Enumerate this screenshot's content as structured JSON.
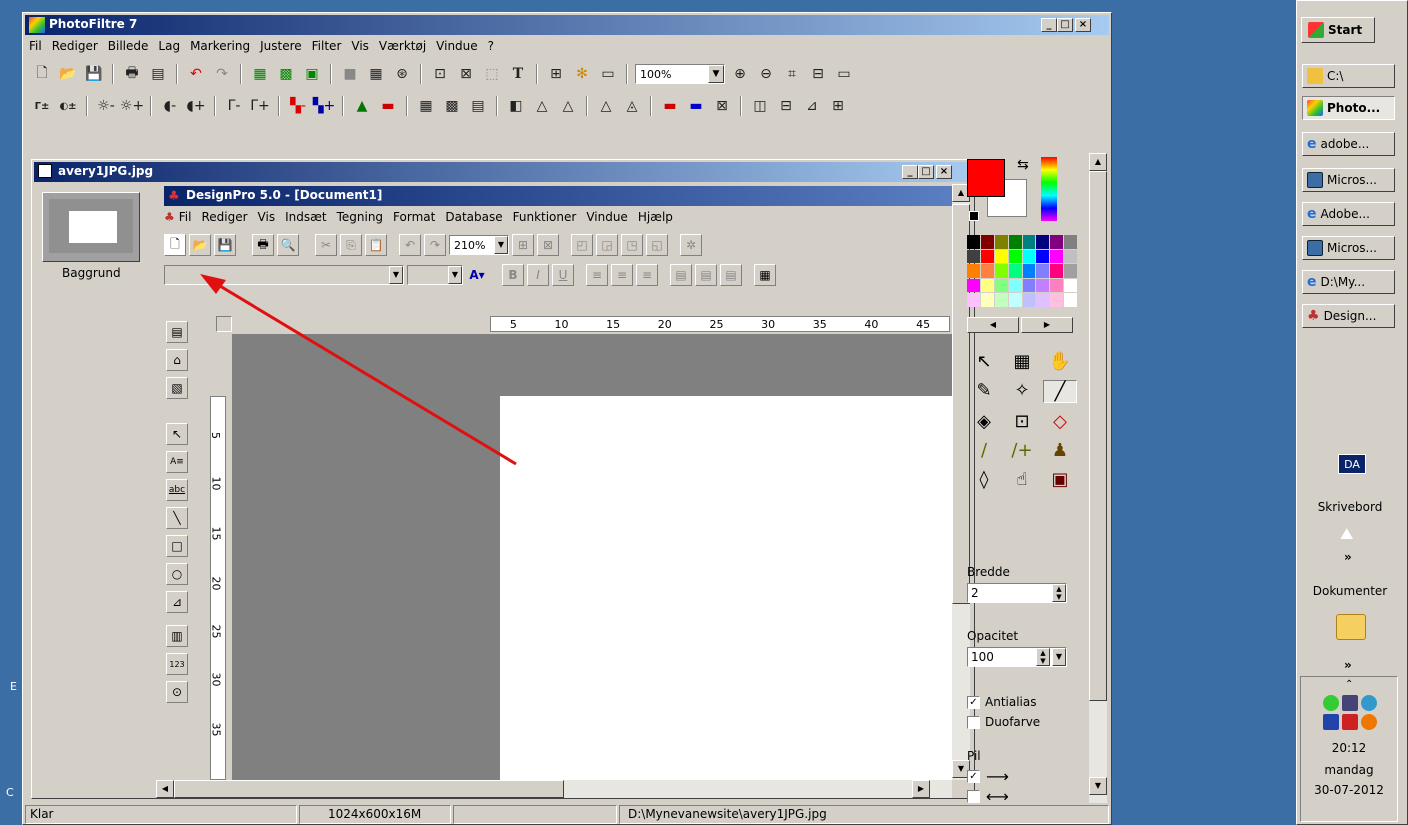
{
  "pf": {
    "title": "PhotoFiltre 7",
    "menu": [
      "Fil",
      "Rediger",
      "Billede",
      "Lag",
      "Markering",
      "Justere",
      "Filter",
      "Vis",
      "Værktøj",
      "Vindue",
      "?"
    ],
    "zoom": "100%",
    "doc_title": "avery1JPG.jpg",
    "layer_label": "Baggrund",
    "status": {
      "ready": "Klar",
      "size": "1024x600x16M",
      "path": "D:\\Mynevanewsite\\avery1JPG.jpg"
    },
    "panel": {
      "bredde_label": "Bredde",
      "bredde_value": "2",
      "opacitet_label": "Opacitet",
      "opacitet_value": "100",
      "antialias": "Antialias",
      "duofarve": "Duofarve",
      "pil": "Pil"
    }
  },
  "dp": {
    "title": "DesignPro 5.0 - [Document1]",
    "menu": [
      "Fil",
      "Rediger",
      "Vis",
      "Indsæt",
      "Tegning",
      "Format",
      "Database",
      "Funktioner",
      "Vindue",
      "Hjælp"
    ],
    "zoom": "210%",
    "ruler_h": [
      "5",
      "10",
      "15",
      "20",
      "25",
      "30",
      "35",
      "40",
      "45"
    ],
    "ruler_v": [
      "5",
      "10",
      "15",
      "20",
      "25",
      "30",
      "35"
    ]
  },
  "taskbar": {
    "start": "Start",
    "items": [
      "C:\\",
      "Photo...",
      "adobe...",
      "Micros...",
      "Adobe...",
      "Micros...",
      "D:\\My...",
      "Design..."
    ],
    "lang": "DA",
    "skrivebord": "Skrivebord",
    "dokumenter": "Dokumenter",
    "chev": "»",
    "time": "20:12",
    "day": "mandag",
    "date": "30-07-2012"
  },
  "colors": {
    "titlebar": "#0a246a",
    "desktop": "#3a6ea5",
    "fg": "#ff0000",
    "arrow": "#e01010"
  }
}
